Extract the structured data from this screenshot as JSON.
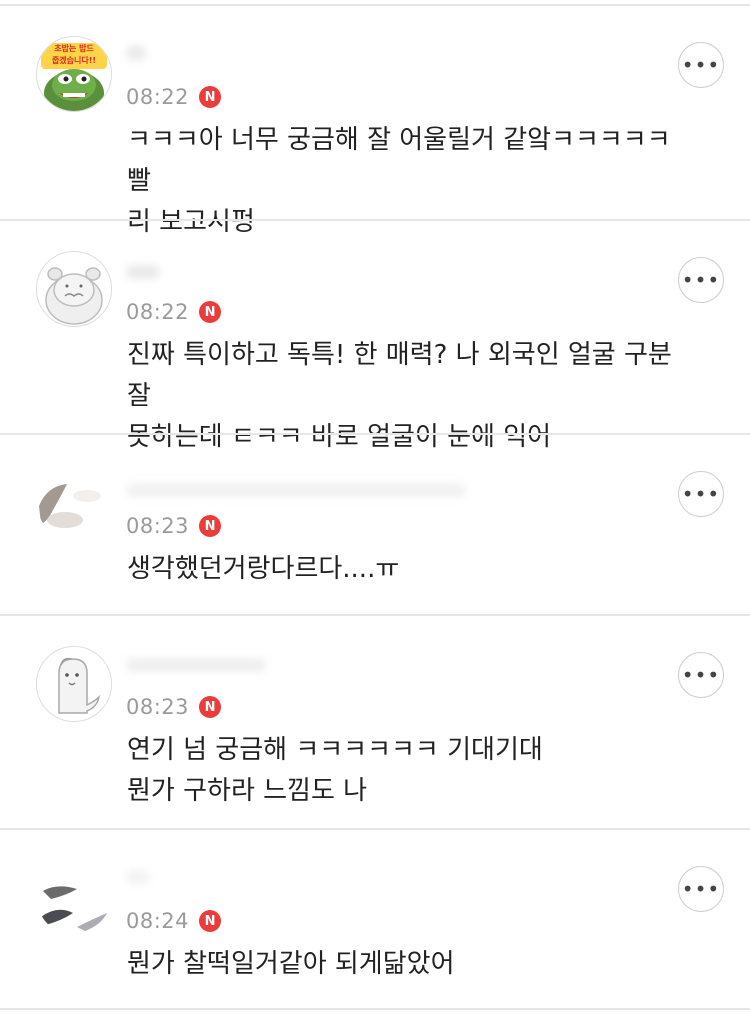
{
  "comments": [
    {
      "time": "08:22",
      "badge": "N",
      "text": "ㅋㅋㅋ아 너무 궁금해 잘 어울릴거 같앜ㅋㅋㅋㅋㅋ 빨\n리 보고시펑",
      "avatar_overlay": "초밥는 밥드\n줍겠습니다!!",
      "more": "•••"
    },
    {
      "time": "08:22",
      "badge": "N",
      "text": "진짜 특이하고 독특! 한 매력? 나 외국인 얼굴 구분 잘\n못하는데 ㅌㅋㅋ 바로 얼굴이 눈에 익어",
      "more": "•••"
    },
    {
      "time": "08:23",
      "badge": "N",
      "text": "생각했던거랑다르다....ㅠ",
      "more": "•••"
    },
    {
      "time": "08:23",
      "badge": "N",
      "text": "연기 넘 궁금해 ㅋㅋㅋㅋㅋㅋ 기대기대\n뭔가 구하라 느낌도 나",
      "more": "•••"
    },
    {
      "time": "08:24",
      "badge": "N",
      "text": "뭔가 찰떡일거같아 되게닮았어",
      "more": "•••"
    }
  ],
  "colors": {
    "badge": "#ec3b3b",
    "time": "#9a9a9a",
    "text": "#222222",
    "divider": "#e6e6e6"
  },
  "icons": {
    "more": "more-dots-icon",
    "badge": "new-badge-icon"
  }
}
